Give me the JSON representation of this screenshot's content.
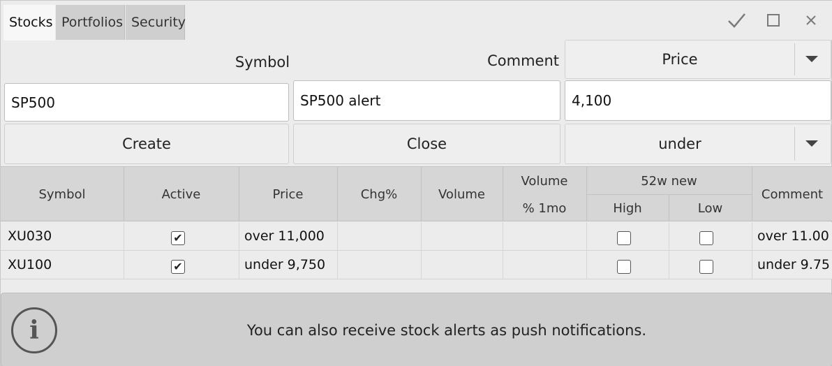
{
  "tabs": [
    {
      "label": "Stocks",
      "active": true
    },
    {
      "label": "Portfolios",
      "active": false
    },
    {
      "label": "Security",
      "active": false
    }
  ],
  "window_controls": {
    "check": "✓",
    "maximize": "☐",
    "close": "✕"
  },
  "form": {
    "symbol_label": "Symbol",
    "comment_label": "Comment",
    "field_dropdown": "Price",
    "symbol_value": "SP500",
    "comment_value": "SP500 alert",
    "price_value": "4,100",
    "create_label": "Create",
    "close_label": "Close",
    "condition_dropdown": "under"
  },
  "table": {
    "headers": {
      "symbol": "Symbol",
      "active": "Active",
      "price": "Price",
      "chg": "Chg%",
      "volume": "Volume",
      "volume_1mo_top": "Volume",
      "volume_1mo_bottom": "% 1mo",
      "new52w": "52w new",
      "high": "High",
      "low": "Low",
      "comment": "Comment"
    },
    "rows": [
      {
        "symbol": "XU030",
        "active": true,
        "price": "over 11,000",
        "chg": "",
        "volume": "",
        "volume_1mo": "",
        "high": false,
        "low": false,
        "comment": "over 11.00"
      },
      {
        "symbol": "XU100",
        "active": true,
        "price": "under 9,750",
        "chg": "",
        "volume": "",
        "volume_1mo": "",
        "high": false,
        "low": false,
        "comment": "under 9.75"
      }
    ]
  },
  "info": {
    "icon": "info-icon",
    "message": "You can also receive stock alerts as push notifications."
  },
  "colors": {
    "background": "#ececec",
    "header_bg": "#d6d6d6",
    "info_bg": "#cfcfcf"
  }
}
